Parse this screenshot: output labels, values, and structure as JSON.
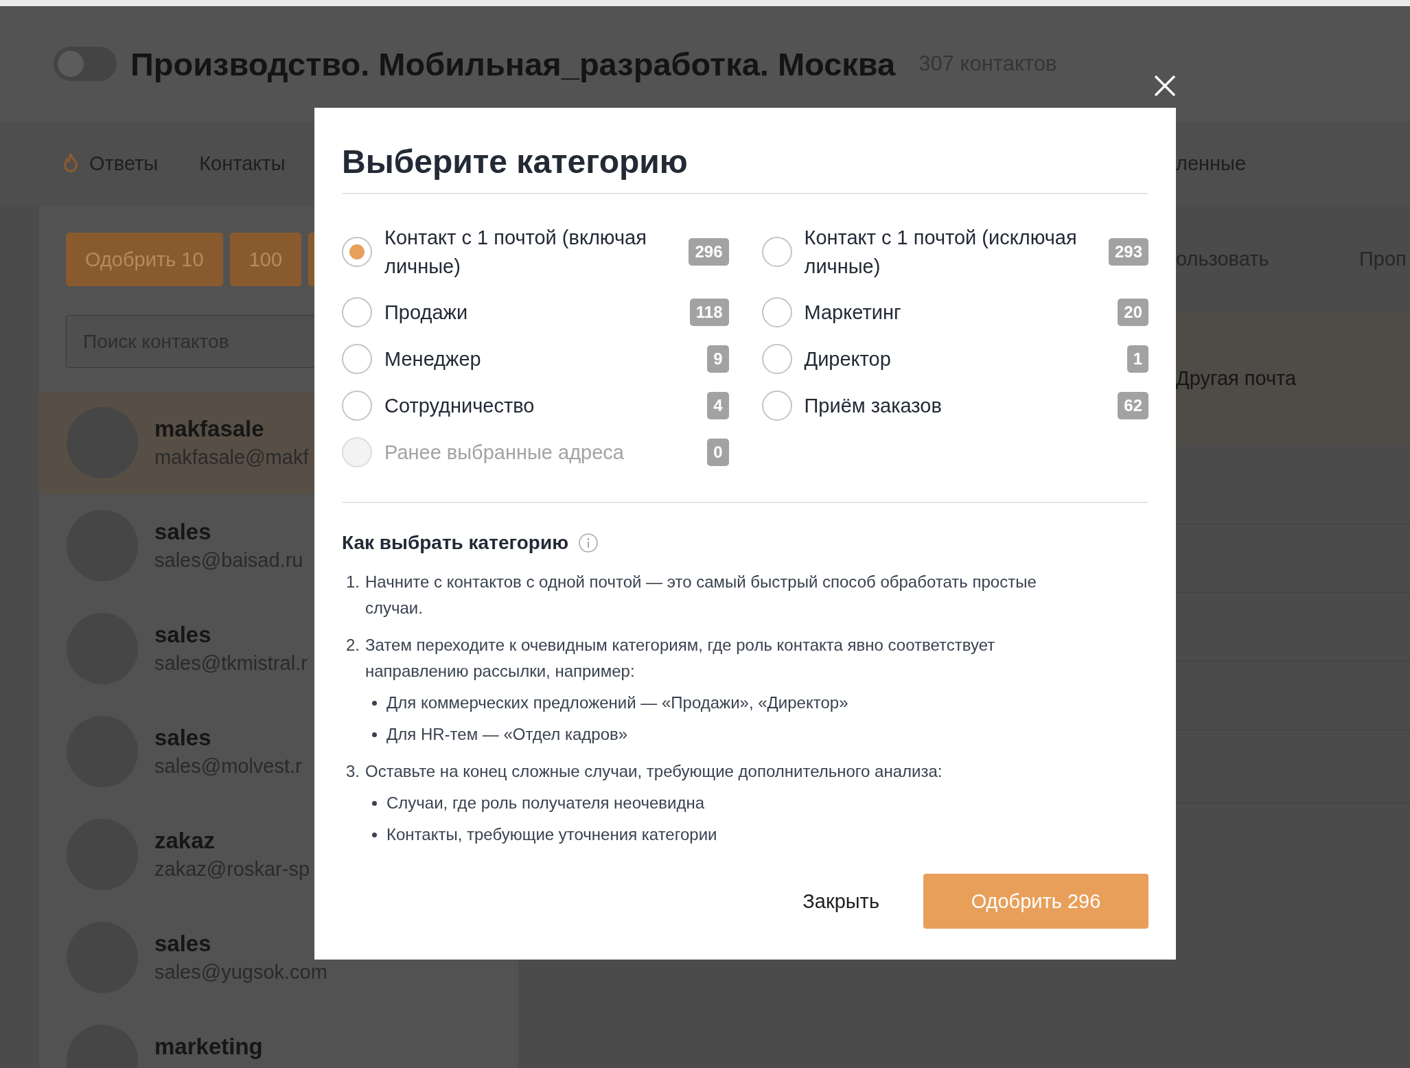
{
  "header": {
    "toggle_on": false,
    "title": "Производство. Мобильная_разработка. Москва",
    "count": "307 контактов"
  },
  "tabs": [
    {
      "label": "Ответы",
      "icon": true
    },
    {
      "label": "Контакты",
      "icon": false
    }
  ],
  "tabs_right_fragment": "ленные",
  "action_buttons": [
    "Одобрить 10",
    "100"
  ],
  "toolbar_fragments": [
    "ользовать",
    "Проп"
  ],
  "search": {
    "placeholder": "Поиск контактов"
  },
  "contacts": [
    {
      "name": "makfasale",
      "email": "makfasale@makf",
      "selected": true
    },
    {
      "name": "sales",
      "email": "sales@baisad.ru",
      "selected": false
    },
    {
      "name": "sales",
      "email": "sales@tkmistral.r",
      "selected": false
    },
    {
      "name": "sales",
      "email": "sales@molvest.r",
      "selected": false
    },
    {
      "name": "zakaz",
      "email": "zakaz@roskar-sp",
      "selected": false
    },
    {
      "name": "sales",
      "email": "sales@yugsok.com",
      "selected": false
    },
    {
      "name": "marketing",
      "selected": false
    }
  ],
  "right_panel": {
    "row_label": "Другая почта"
  },
  "modal": {
    "title": "Выберите категорию",
    "categories": [
      {
        "label": "Контакт с 1 почтой (включая личные)",
        "count": "296",
        "selected": true,
        "disabled": false
      },
      {
        "label": "Контакт с 1 почтой (исключая личные)",
        "count": "293",
        "selected": false,
        "disabled": false
      },
      {
        "label": "Продажи",
        "count": "118",
        "selected": false,
        "disabled": false
      },
      {
        "label": "Маркетинг",
        "count": "20",
        "selected": false,
        "disabled": false
      },
      {
        "label": "Менеджер",
        "count": "9",
        "selected": false,
        "disabled": false
      },
      {
        "label": "Директор",
        "count": "1",
        "selected": false,
        "disabled": false
      },
      {
        "label": "Сотрудничество",
        "count": "4",
        "selected": false,
        "disabled": false
      },
      {
        "label": "Приём заказов",
        "count": "62",
        "selected": false,
        "disabled": false
      },
      {
        "label": "Ранее выбранные адреса",
        "count": "0",
        "selected": false,
        "disabled": true
      }
    ],
    "help_title": "Как выбрать категорию",
    "steps": [
      {
        "number": "1.",
        "text": "Начните с контактов с одной почтой — это самый быстрый способ обработать простые случаи."
      },
      {
        "number": "2.",
        "text": "Затем переходите к очевидным категориям, где роль контакта явно соответствует направлению рассылки, например:",
        "bullets": [
          "Для коммерческих предложений — «Продажи», «Директор»",
          "Для HR-тем — «Отдел кадров»"
        ]
      },
      {
        "number": "3.",
        "text": "Оставьте на конец сложные случаи, требующие дополнительного анализа:",
        "bullets": [
          "Случаи, где роль получателя неочевидна",
          "Контакты, требующие уточнения категории"
        ]
      }
    ],
    "close_label": "Закрыть",
    "approve_label": "Одобрить 296"
  }
}
